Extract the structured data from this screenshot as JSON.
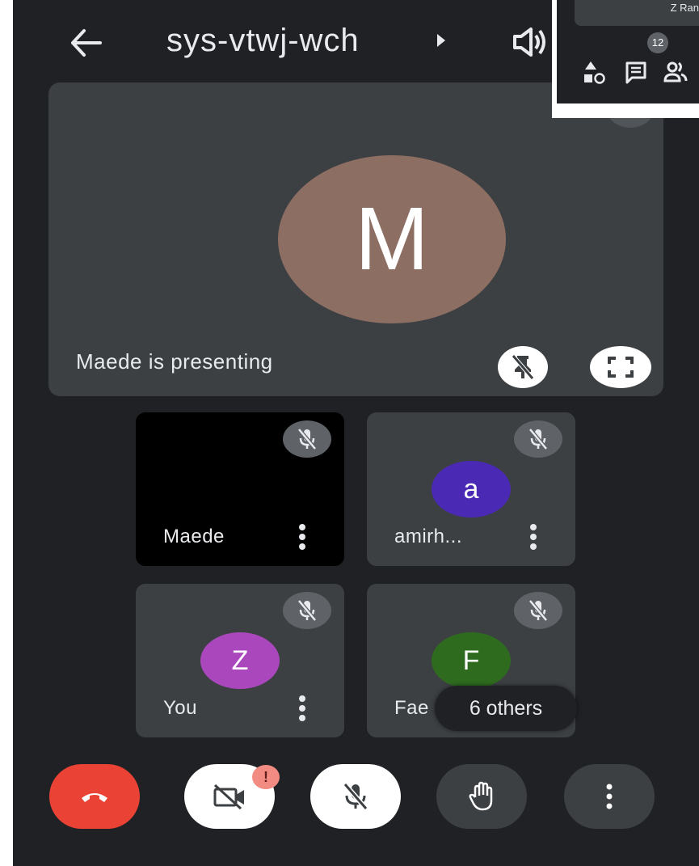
{
  "header": {
    "meeting_code": "sys-vtwj-wch",
    "back_icon": "arrow-left-icon",
    "speaker_icon": "speaker-icon"
  },
  "presenter": {
    "avatar_initial": "M",
    "avatar_color": "#8d6e63",
    "status_text": "Maede is presenting",
    "pin_icon": "unpin-icon",
    "fullscreen_icon": "fullscreen-icon"
  },
  "participants": [
    {
      "name": "Maede",
      "initial": "",
      "color": "#000000"
    },
    {
      "name": "amirh...",
      "initial": "a",
      "color": "#4a2ab5"
    },
    {
      "name": "You",
      "initial": "Z",
      "color": "#ab47bc"
    },
    {
      "name": "Fae",
      "initial": "F",
      "color": "#2e6b1f"
    }
  ],
  "others_label": "6 others",
  "controls": {
    "end_call_icon": "end-call-icon",
    "camera_icon": "camera-off-icon",
    "camera_alert": "!",
    "mic_icon": "mic-off-icon",
    "hand_icon": "raise-hand-icon",
    "more_icon": "more-vert-icon"
  },
  "mini_panel": {
    "strip_text": "Z Ran",
    "badge_count": "12",
    "icons": [
      "activities-icon",
      "chat-icon",
      "people-icon"
    ]
  },
  "colors": {
    "background": "#202124",
    "tile": "#3c4043",
    "end_call": "#ea4335",
    "alert": "#f28b82"
  }
}
